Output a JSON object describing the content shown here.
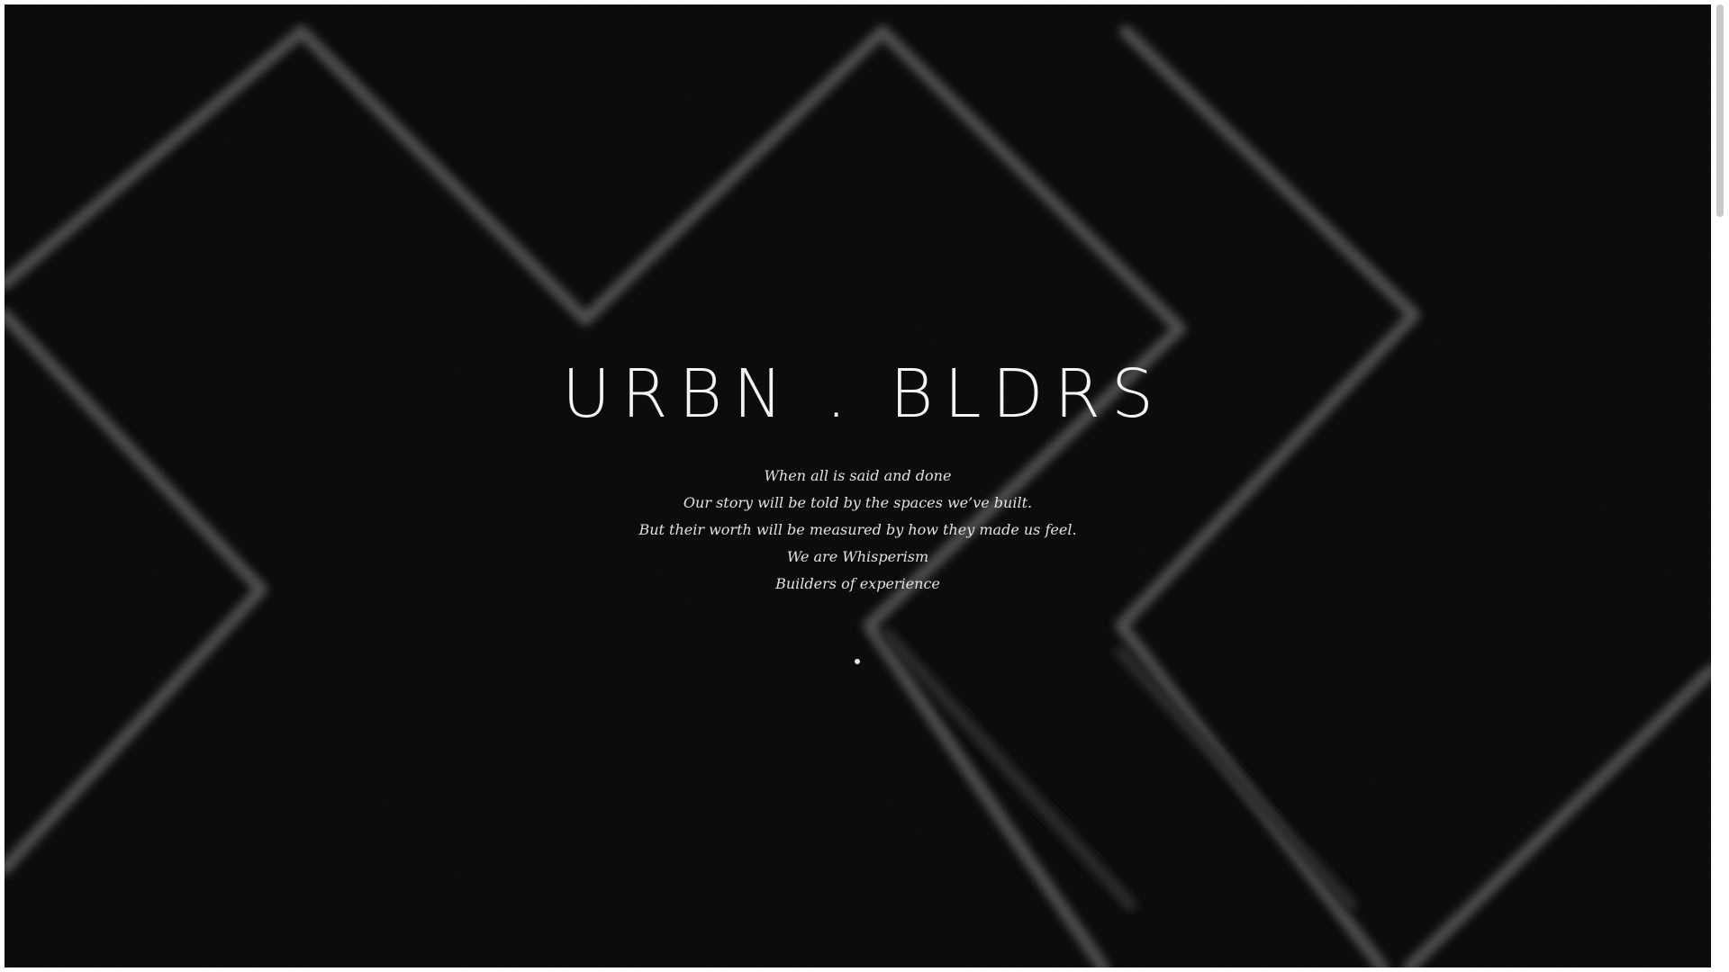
{
  "brand": {
    "logo_text": "URBN . BLDRS"
  },
  "manifesto": {
    "lines": [
      "When all is said and done",
      "Our story will be told by the spaces we’ve built.",
      "But their worth will be measured by how they made us feel.",
      "We are Whisperism",
      "Builders of experience"
    ]
  },
  "colors": {
    "background": "#0b0b0b",
    "text": "#f4f4f4",
    "pattern_stroke": "#5a5a5a"
  },
  "icons": {
    "scroll_indicator": "dot-icon"
  }
}
